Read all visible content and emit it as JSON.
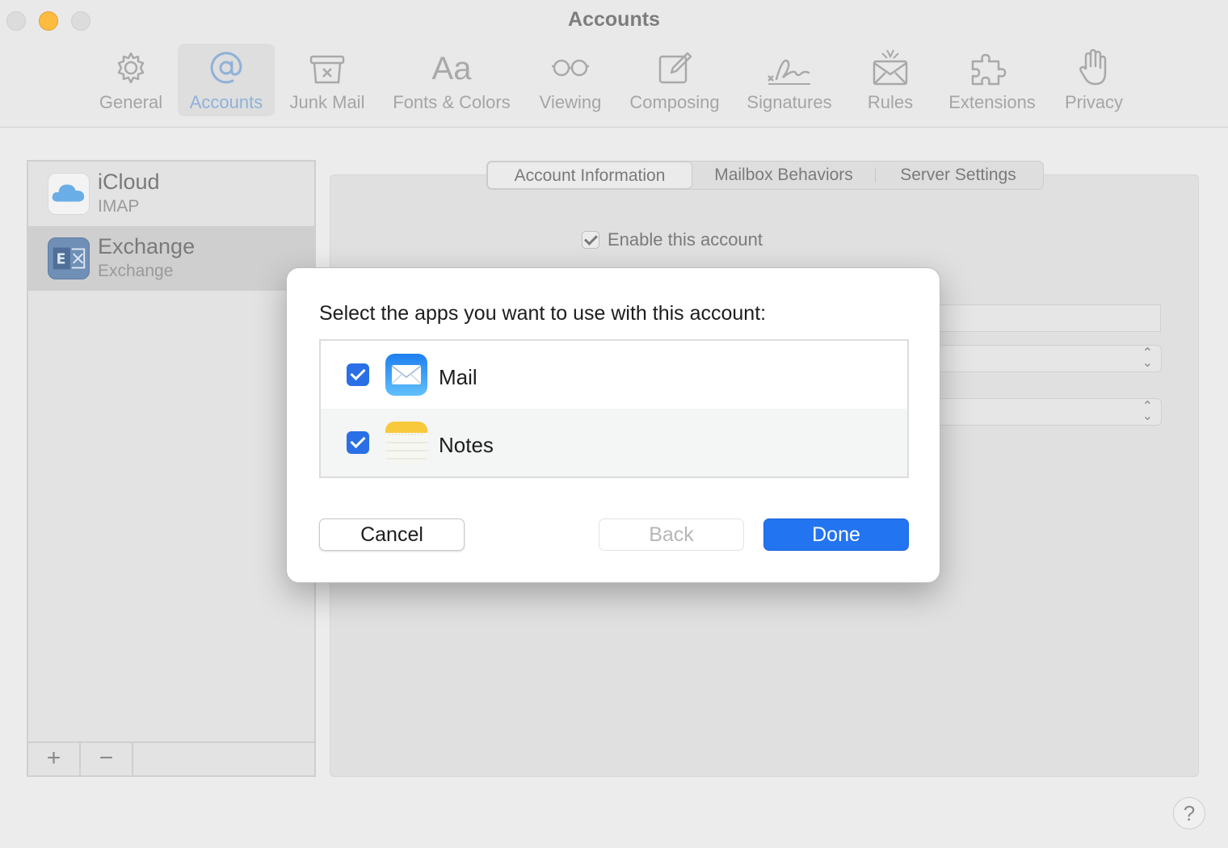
{
  "window": {
    "title": "Accounts"
  },
  "toolbar": {
    "items": [
      {
        "label": "General",
        "icon": "gear-icon"
      },
      {
        "label": "Accounts",
        "icon": "at-sign-icon"
      },
      {
        "label": "Junk Mail",
        "icon": "junk-mail-icon"
      },
      {
        "label": "Fonts & Colors",
        "icon": "fonts-icon",
        "glyph": "Aa"
      },
      {
        "label": "Viewing",
        "icon": "glasses-icon"
      },
      {
        "label": "Composing",
        "icon": "compose-icon"
      },
      {
        "label": "Signatures",
        "icon": "signature-icon"
      },
      {
        "label": "Rules",
        "icon": "rules-icon"
      },
      {
        "label": "Extensions",
        "icon": "puzzle-icon"
      },
      {
        "label": "Privacy",
        "icon": "hand-icon"
      }
    ]
  },
  "sidebar": {
    "accounts": [
      {
        "name": "iCloud",
        "type": "IMAP",
        "icon": "icloud-icon"
      },
      {
        "name": "Exchange",
        "type": "Exchange",
        "icon": "exchange-icon"
      }
    ],
    "add_label": "+",
    "remove_label": "−"
  },
  "tabs": [
    "Account Information",
    "Mailbox Behaviors",
    "Server Settings"
  ],
  "account_info": {
    "enable_label": "Enable this account"
  },
  "sheet": {
    "prompt": "Select the apps you want to use with this account:",
    "apps": [
      {
        "name": "Mail",
        "checked": true,
        "icon": "mail-app-icon"
      },
      {
        "name": "Notes",
        "checked": true,
        "icon": "notes-app-icon"
      }
    ],
    "cancel_label": "Cancel",
    "back_label": "Back",
    "done_label": "Done"
  },
  "help_label": "?",
  "colors": {
    "accent": "#2374f0",
    "checkbox": "#2a6fe6",
    "minimize": "#fdbc40"
  }
}
